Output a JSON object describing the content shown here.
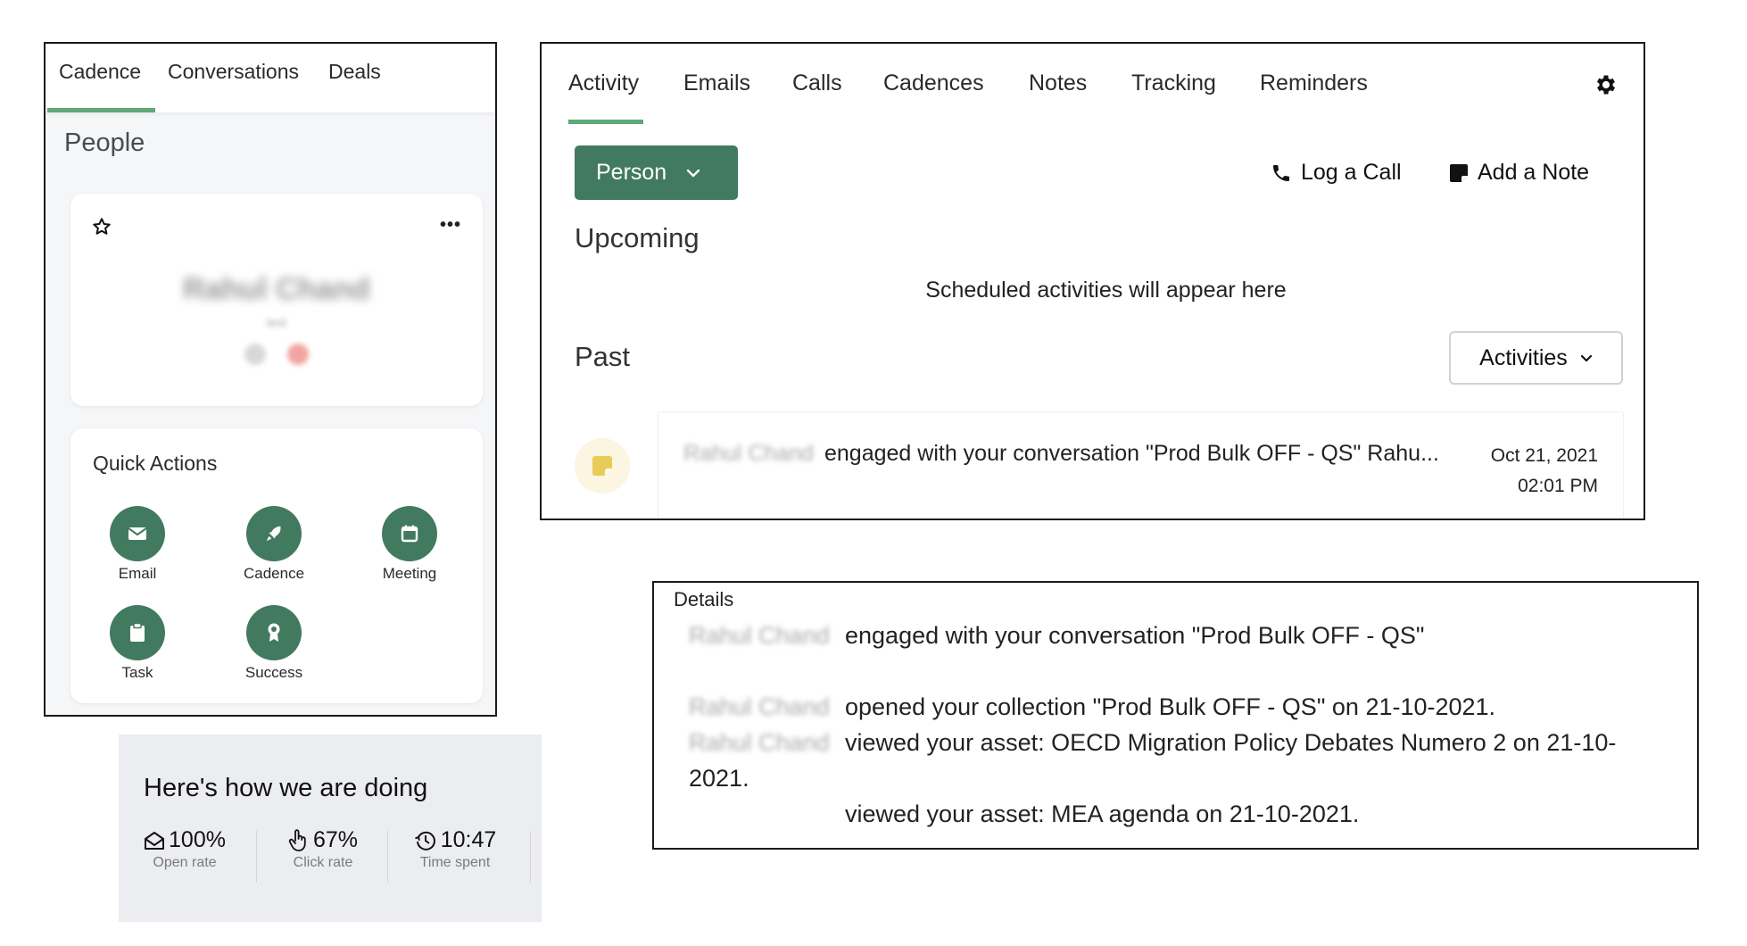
{
  "left_panel": {
    "tabs": [
      {
        "label": "Cadence",
        "active": true
      },
      {
        "label": "Conversations",
        "active": false
      },
      {
        "label": "Deals",
        "active": false
      }
    ],
    "section_title": "People",
    "person_card": {
      "name": "Rahul Chand",
      "subtitle": "test",
      "more_label": "•••"
    },
    "quick_actions": {
      "title": "Quick Actions",
      "items": [
        {
          "label": "Email",
          "icon": "envelope-icon"
        },
        {
          "label": "Cadence",
          "icon": "rocket-icon"
        },
        {
          "label": "Meeting",
          "icon": "calendar-icon"
        },
        {
          "label": "Task",
          "icon": "clipboard-icon"
        },
        {
          "label": "Success",
          "icon": "award-icon"
        }
      ]
    }
  },
  "stats": {
    "title": "Here's how we are doing",
    "items": [
      {
        "value": "100%",
        "label": "Open rate",
        "icon": "open-envelope-icon"
      },
      {
        "value": "67%",
        "label": "Click rate",
        "icon": "pointer-hand-icon"
      },
      {
        "value": "10:47",
        "label": "Time spent",
        "icon": "history-clock-icon"
      }
    ]
  },
  "activity_panel": {
    "tabs": [
      {
        "label": "Activity",
        "active": true
      },
      {
        "label": "Emails",
        "active": false
      },
      {
        "label": "Calls",
        "active": false
      },
      {
        "label": "Cadences",
        "active": false
      },
      {
        "label": "Notes",
        "active": false
      },
      {
        "label": "Tracking",
        "active": false
      },
      {
        "label": "Reminders",
        "active": false
      }
    ],
    "person_filter": "Person",
    "log_call_label": "Log a Call",
    "add_note_label": "Add a Note",
    "upcoming_title": "Upcoming",
    "upcoming_empty": "Scheduled activities will appear here",
    "past_title": "Past",
    "activities_filter": "Activities",
    "past_items": [
      {
        "name": "Rahul Chand",
        "text": "engaged with your conversation \"Prod Bulk OFF - QS\" Rahu...",
        "date": "Oct 21, 2021",
        "time": "02:01 PM"
      }
    ]
  },
  "details": {
    "title": "Details",
    "lines": [
      {
        "name": "Rahul Chand",
        "text": "engaged with your conversation \"Prod Bulk OFF - QS\""
      },
      {
        "name": "Rahul Chand",
        "text": "opened your collection \"Prod Bulk OFF - QS\" on 21-10-2021."
      },
      {
        "name": "Rahul Chand",
        "text": "viewed your asset: OECD Migration Policy Debates Numero 2 on 21-10-"
      },
      {
        "name": "",
        "text": "2021."
      },
      {
        "name": "",
        "text": "viewed your asset: MEA agenda on 21-10-2021."
      }
    ]
  },
  "colors": {
    "primary_green": "#427a60",
    "tab_underline_green": "#5fa878",
    "note_yellow": "#e8cc5a",
    "stats_bg": "#ecedf0"
  }
}
